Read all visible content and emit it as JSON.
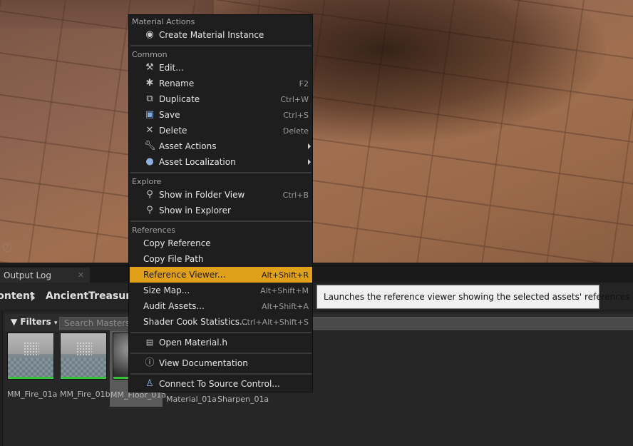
{
  "tabs": {
    "output_log": "Output Log",
    "close": "✕"
  },
  "breadcrumb": {
    "content": "Content",
    "folder": "AncientTreasures"
  },
  "filters": {
    "label": "Filters",
    "search_placeholder": "Search Masters"
  },
  "assets": [
    {
      "label": "MM_Fire_01a"
    },
    {
      "label": "MM_Fire_01b"
    },
    {
      "label": "MM_Floor_01a"
    },
    {
      "label": "Material_01a"
    },
    {
      "label": "Sharpen_01a"
    }
  ],
  "menu": {
    "sections": {
      "material_actions": "Material Actions",
      "common": "Common",
      "explore": "Explore",
      "references": "References"
    },
    "items": {
      "create_material_instance": {
        "label": "Create Material Instance",
        "icon": "material-instance-icon"
      },
      "edit": {
        "label": "Edit...",
        "icon": "hammer-icon"
      },
      "rename": {
        "label": "Rename",
        "shortcut": "F2",
        "icon": "rename-icon"
      },
      "duplicate": {
        "label": "Duplicate",
        "shortcut": "Ctrl+W",
        "icon": "duplicate-icon"
      },
      "save": {
        "label": "Save",
        "shortcut": "Ctrl+S",
        "icon": "floppy-icon"
      },
      "delete": {
        "label": "Delete",
        "shortcut": "Delete",
        "icon": "x-icon"
      },
      "asset_actions": {
        "label": "Asset Actions",
        "icon": "wrench-icon"
      },
      "asset_localization": {
        "label": "Asset Localization",
        "icon": "globe-icon"
      },
      "show_in_folder_view": {
        "label": "Show in Folder View",
        "shortcut": "Ctrl+B",
        "icon": "magnifier-icon"
      },
      "show_in_explorer": {
        "label": "Show in Explorer",
        "icon": "magnifier-icon"
      },
      "copy_reference": {
        "label": "Copy Reference"
      },
      "copy_file_path": {
        "label": "Copy File Path"
      },
      "reference_viewer": {
        "label": "Reference Viewer...",
        "shortcut": "Alt+Shift+R"
      },
      "size_map": {
        "label": "Size Map...",
        "shortcut": "Alt+Shift+M"
      },
      "audit_assets": {
        "label": "Audit Assets...",
        "shortcut": "Alt+Shift+A"
      },
      "shader_cook_statistics": {
        "label": "Shader Cook Statistics...",
        "shortcut": "Ctrl+Alt+Shift+S"
      },
      "open_material_h": {
        "label": "Open Material.h",
        "icon": "code-file-icon"
      },
      "view_documentation": {
        "label": "View Documentation",
        "icon": "help-icon"
      },
      "connect_source_control": {
        "label": "Connect To Source Control...",
        "icon": "source-control-icon"
      }
    }
  },
  "tooltip": {
    "text": "Launches the reference viewer showing the selected assets' references"
  },
  "colors": {
    "highlight": "#e0a01a",
    "menu_bg": "#1e1e1e",
    "tooltip_bg": "#f0f0f0"
  }
}
